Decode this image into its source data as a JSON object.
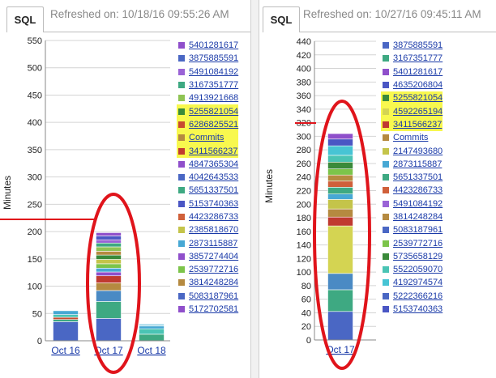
{
  "left": {
    "tab_label": "SQL",
    "refreshed": "Refreshed on: 10/18/16 09:55:26 AM",
    "ylabel": "Minutes",
    "legend": [
      {
        "label": "5401281617",
        "color": "#8f4fcb",
        "highlight": false
      },
      {
        "label": "3875885591",
        "color": "#4a67c4",
        "highlight": false
      },
      {
        "label": "5491084192",
        "color": "#9a63d6",
        "highlight": false
      },
      {
        "label": "3167351777",
        "color": "#3ea982",
        "highlight": false
      },
      {
        "label": "4913921668",
        "color": "#8fc454",
        "highlight": false
      },
      {
        "label": "5255821054",
        "color": "#3a8a3a",
        "highlight": true
      },
      {
        "label": "6286825521",
        "color": "#c84a30",
        "highlight": true
      },
      {
        "label": "Commits",
        "color": "#b58a40",
        "highlight": true
      },
      {
        "label": "3411566237",
        "color": "#c03a30",
        "highlight": true
      },
      {
        "label": "4847365304",
        "color": "#8f4fcb",
        "highlight": false
      },
      {
        "label": "4042643533",
        "color": "#4a67c4",
        "highlight": false
      },
      {
        "label": "5651337501",
        "color": "#3ea982",
        "highlight": false
      },
      {
        "label": "5153740363",
        "color": "#4a56c4",
        "highlight": false
      },
      {
        "label": "4423286733",
        "color": "#d0603a",
        "highlight": false
      },
      {
        "label": "2385818670",
        "color": "#c4c44a",
        "highlight": false
      },
      {
        "label": "2873115887",
        "color": "#47a8d4",
        "highlight": false
      },
      {
        "label": "3857274404",
        "color": "#8f4fcb",
        "highlight": false
      },
      {
        "label": "2539772716",
        "color": "#7cc44a",
        "highlight": false
      },
      {
        "label": "3814248284",
        "color": "#b58a40",
        "highlight": false
      },
      {
        "label": "5083187961",
        "color": "#4a67c4",
        "highlight": false
      },
      {
        "label": "5172702581",
        "color": "#8f4fcb",
        "highlight": false
      }
    ]
  },
  "right": {
    "tab_label": "SQL",
    "refreshed": "Refreshed on: 10/27/16 09:45:11 AM",
    "ylabel": "Minutes",
    "legend": [
      {
        "label": "3875885591",
        "color": "#4a67c4",
        "highlight": false
      },
      {
        "label": "3167351777",
        "color": "#3ea982",
        "highlight": false
      },
      {
        "label": "5401281617",
        "color": "#8f4fcb",
        "highlight": false
      },
      {
        "label": "4635206804",
        "color": "#4a56c4",
        "highlight": false
      },
      {
        "label": "5255821054",
        "color": "#3a8a3a",
        "highlight": true
      },
      {
        "label": "4592265194",
        "color": "#d4d452",
        "highlight": true
      },
      {
        "label": "3411566237",
        "color": "#c03a30",
        "highlight": true
      },
      {
        "label": "Commits",
        "color": "#b58a40",
        "highlight": false
      },
      {
        "label": "2147493680",
        "color": "#c4c44a",
        "highlight": false
      },
      {
        "label": "2873115887",
        "color": "#47a8d4",
        "highlight": false
      },
      {
        "label": "5651337501",
        "color": "#3ea982",
        "highlight": false
      },
      {
        "label": "4423286733",
        "color": "#d0603a",
        "highlight": false
      },
      {
        "label": "5491084192",
        "color": "#9a63d6",
        "highlight": false
      },
      {
        "label": "3814248284",
        "color": "#b58a40",
        "highlight": false
      },
      {
        "label": "5083187961",
        "color": "#4a67c4",
        "highlight": false
      },
      {
        "label": "2539772716",
        "color": "#7cc44a",
        "highlight": false
      },
      {
        "label": "5735658129",
        "color": "#3a8a3a",
        "highlight": false
      },
      {
        "label": "5522059070",
        "color": "#4ac4b4",
        "highlight": false
      },
      {
        "label": "4192974574",
        "color": "#47c4d4",
        "highlight": false
      },
      {
        "label": "5222366216",
        "color": "#4a67c4",
        "highlight": false
      },
      {
        "label": "5153740363",
        "color": "#4a56c4",
        "highlight": false
      }
    ]
  },
  "chart_data": [
    {
      "type": "bar",
      "stacked": true,
      "ylabel": "Minutes",
      "ylim": [
        0,
        550
      ],
      "yticks": [
        0,
        50,
        100,
        150,
        200,
        250,
        300,
        350,
        400,
        450,
        500,
        550
      ],
      "grid": true,
      "categories": [
        "Oct 16",
        "Oct 17",
        "Oct 18"
      ],
      "stacks": [
        [
          {
            "value": 35,
            "color": "#4a67c4"
          },
          {
            "value": 4,
            "color": "#3ea982"
          },
          {
            "value": 4,
            "color": "#c84a30"
          },
          {
            "value": 5,
            "color": "#4ac4b4"
          },
          {
            "value": 7,
            "color": "#47a8d4"
          }
        ],
        [
          {
            "value": 41,
            "color": "#4a67c4"
          },
          {
            "value": 31,
            "color": "#3ea982"
          },
          {
            "value": 20,
            "color": "#4a8ac4"
          },
          {
            "value": 14,
            "color": "#b58a40"
          },
          {
            "value": 13,
            "color": "#c03a30"
          },
          {
            "value": 7,
            "color": "#8f4fcb"
          },
          {
            "value": 7,
            "color": "#47a8d4"
          },
          {
            "value": 8,
            "color": "#7cc44a"
          },
          {
            "value": 8,
            "color": "#c4c44a"
          },
          {
            "value": 8,
            "color": "#3a8a3a"
          },
          {
            "value": 7,
            "color": "#b58a40"
          },
          {
            "value": 8,
            "color": "#8fc454"
          },
          {
            "value": 7,
            "color": "#3ea982"
          },
          {
            "value": 6,
            "color": "#9a63d6"
          },
          {
            "value": 7,
            "color": "#4a56c4"
          },
          {
            "value": 6,
            "color": "#8f4fcb"
          }
        ],
        [
          {
            "value": 12,
            "color": "#3ea982"
          },
          {
            "value": 10,
            "color": "#4ac4b4"
          },
          {
            "value": 5,
            "color": "#47a8d4"
          },
          {
            "value": 4,
            "color": "#a0d8e8"
          }
        ]
      ]
    },
    {
      "type": "bar",
      "stacked": true,
      "ylabel": "Minutes",
      "ylim": [
        0,
        440
      ],
      "yticks": [
        0,
        20,
        40,
        60,
        80,
        100,
        120,
        140,
        160,
        180,
        200,
        220,
        240,
        260,
        280,
        300,
        320,
        340,
        360,
        380,
        400,
        420,
        440
      ],
      "grid": true,
      "categories": [
        "Oct 17"
      ],
      "stacks": [
        [
          {
            "value": 42,
            "color": "#4a67c4"
          },
          {
            "value": 32,
            "color": "#3ea982"
          },
          {
            "value": 24,
            "color": "#4a8ac4"
          },
          {
            "value": 70,
            "color": "#d4d452"
          },
          {
            "value": 13,
            "color": "#c03a30"
          },
          {
            "value": 12,
            "color": "#b58a40"
          },
          {
            "value": 14,
            "color": "#c4c44a"
          },
          {
            "value": 8,
            "color": "#47a8d4"
          },
          {
            "value": 10,
            "color": "#3ea982"
          },
          {
            "value": 9,
            "color": "#d0603a"
          },
          {
            "value": 9,
            "color": "#b58a40"
          },
          {
            "value": 9,
            "color": "#7cc44a"
          },
          {
            "value": 10,
            "color": "#3a8a3a"
          },
          {
            "value": 10,
            "color": "#4ac4b4"
          },
          {
            "value": 14,
            "color": "#47c4d4"
          },
          {
            "value": 10,
            "color": "#4a56c4"
          },
          {
            "value": 8,
            "color": "#8f4fcb"
          }
        ]
      ]
    }
  ]
}
